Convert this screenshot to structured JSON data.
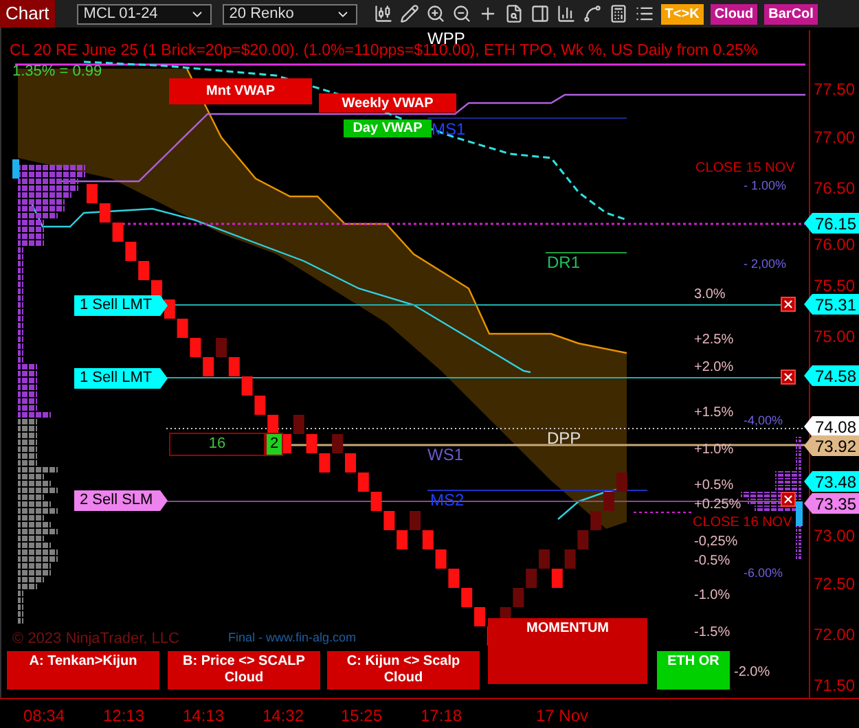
{
  "toolbar": {
    "title": "Chart",
    "instrument": "MCL 01-24",
    "bar_type": "20 Renko",
    "toggles": [
      {
        "label": "T<>K",
        "color": "#f5a000"
      },
      {
        "label": "Cloud",
        "color": "#c0188c"
      },
      {
        "label": "BarCol",
        "color": "#c0188c"
      }
    ]
  },
  "chart": {
    "header": "CL 20 RE June 25 (1 Brick=20p=$20.00). (1.0%=110pps=$110.00), ETH TPO, Wk %, US Daily from 0.25%",
    "ratio": "1.35% = 0.99",
    "vwap_labels": [
      {
        "label": "Mnt VWAP",
        "color": "#e00000"
      },
      {
        "label": "Weekly VWAP",
        "color": "#e00000"
      },
      {
        "label": "Day VWAP",
        "color": "#00c000"
      }
    ],
    "pivot_labels": [
      {
        "label": "WPP",
        "color": "#ffffff"
      },
      {
        "label": "MS1",
        "color": "#2040ff"
      },
      {
        "label": "DR1",
        "color": "#20c060"
      },
      {
        "label": "DPP",
        "color": "#e0e0e0"
      },
      {
        "label": "WS1",
        "color": "#6a5acd"
      },
      {
        "label": "MS2",
        "color": "#2040ff"
      }
    ],
    "close_labels": [
      "CLOSE 15 NOV",
      "CLOSE 16 NOV"
    ],
    "daily_percent_labels": [
      "3.0%",
      "+2.5%",
      "+2.0%",
      "+1.5%",
      "+1.0%",
      "+0.5%",
      "+0.25%",
      "-0,25%",
      "-0.5%",
      "-1.0%",
      "-1.5%",
      "-2.0%"
    ],
    "weekly_percent_labels": [
      "- 1.00%",
      "- 2,00%",
      "-4,00%",
      "-6.00%"
    ],
    "order_flags": [
      {
        "label": "1 Sell LMT",
        "color": "#00ffff"
      },
      {
        "label": "1 Sell LMT",
        "color": "#00ffff"
      },
      {
        "label": "2 Sell SLM",
        "color": "#ee82ee"
      }
    ],
    "position": {
      "quantity": "16",
      "count": "2"
    },
    "price_flags": [
      {
        "label": "76.15",
        "color": "#00ffff"
      },
      {
        "label": "75.31",
        "color": "#00ffff"
      },
      {
        "label": "74.58",
        "color": "#00ffff"
      },
      {
        "label": "74.08",
        "color": "#ffffff"
      },
      {
        "label": "73.92",
        "color": "#deb887"
      },
      {
        "label": "73.48",
        "color": "#00ffff"
      },
      {
        "label": "73.35",
        "color": "#ee82ee"
      }
    ],
    "price_ticks": [
      "77.50",
      "77.00",
      "76.50",
      "76.00",
      "75.50",
      "75.00",
      "73.00",
      "72.50",
      "72.00",
      "71.50"
    ],
    "signal_boxes": [
      {
        "label": "A: Tenkan>Kijun",
        "color": "#d00000"
      },
      {
        "label": "B: Price <> SCALP Cloud",
        "color": "#d00000"
      },
      {
        "label": "C: Kijun <> Scalp Cloud",
        "color": "#d00000"
      },
      {
        "label": "MOMENTUM",
        "color": "#c80000"
      },
      {
        "label": "ETH OR",
        "color": "#00d000"
      }
    ],
    "watermarks": [
      "© 2023 NinjaTrader, LLC",
      "Final - www.fin-alg.com"
    ],
    "time_labels": [
      "08:34",
      "12:13",
      "14:13",
      "14:32",
      "15:25",
      "17:18",
      "17 Nov"
    ]
  }
}
